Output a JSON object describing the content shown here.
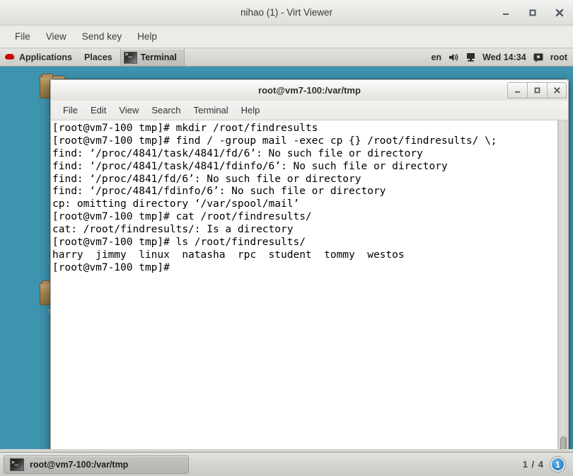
{
  "virt_viewer": {
    "title": "nihao (1) - Virt Viewer",
    "menu": [
      {
        "label": "File"
      },
      {
        "label": "View"
      },
      {
        "label": "Send key"
      },
      {
        "label": "Help"
      }
    ],
    "window_buttons": {
      "minimize": "minimize-icon",
      "maximize": "maximize-icon",
      "close": "close-icon"
    }
  },
  "gnome_panel": {
    "applications": "Applications",
    "places": "Places",
    "active_task": "Terminal",
    "logo_icon": "redhat-logo-icon",
    "task_icon": "terminal-icon",
    "keyboard_layout": "en",
    "volume_icon": "volume-icon",
    "display_icon": "display-icon",
    "clock": "Wed 14:34",
    "user_icon": "user-icon",
    "user": "root"
  },
  "desktop_icons": [
    {
      "name": "desktop-icon-top",
      "label": ""
    },
    {
      "name": "desktop-icon-lower",
      "label": "so"
    }
  ],
  "terminal": {
    "title": "root@vm7-100:/var/tmp",
    "menu": [
      {
        "label": "File"
      },
      {
        "label": "Edit"
      },
      {
        "label": "View"
      },
      {
        "label": "Search"
      },
      {
        "label": "Terminal"
      },
      {
        "label": "Help"
      }
    ],
    "window_buttons": {
      "minimize": "_",
      "maximize": "□",
      "close": "✕"
    },
    "lines": [
      "[root@vm7-100 tmp]# mkdir /root/findresults",
      "[root@vm7-100 tmp]# find / -group mail -exec cp {} /root/findresults/ \\;",
      "find: ‘/proc/4841/task/4841/fd/6’: No such file or directory",
      "find: ‘/proc/4841/task/4841/fdinfo/6’: No such file or directory",
      "find: ‘/proc/4841/fd/6’: No such file or directory",
      "find: ‘/proc/4841/fdinfo/6’: No such file or directory",
      "cp: omitting directory ‘/var/spool/mail’",
      "[root@vm7-100 tmp]# cat /root/findresults/",
      "cat: /root/findresults/: Is a directory",
      "[root@vm7-100 tmp]# ls /root/findresults/",
      "harry  jimmy  linux  natasha  rpc  student  tommy  westos",
      "[root@vm7-100 tmp]#"
    ]
  },
  "bottom_panel": {
    "window_button_label": "root@vm7-100:/var/tmp",
    "window_button_icon": "terminal-icon",
    "workspace_count": "1 / 4",
    "workspace_current": "1"
  },
  "colors": {
    "desktop": "#3e93ae",
    "panel": "#d8d8d4",
    "terminal_bg": "#ffffff",
    "terminal_fg": "#000000",
    "workspace_badge": "#2f8fd4"
  }
}
